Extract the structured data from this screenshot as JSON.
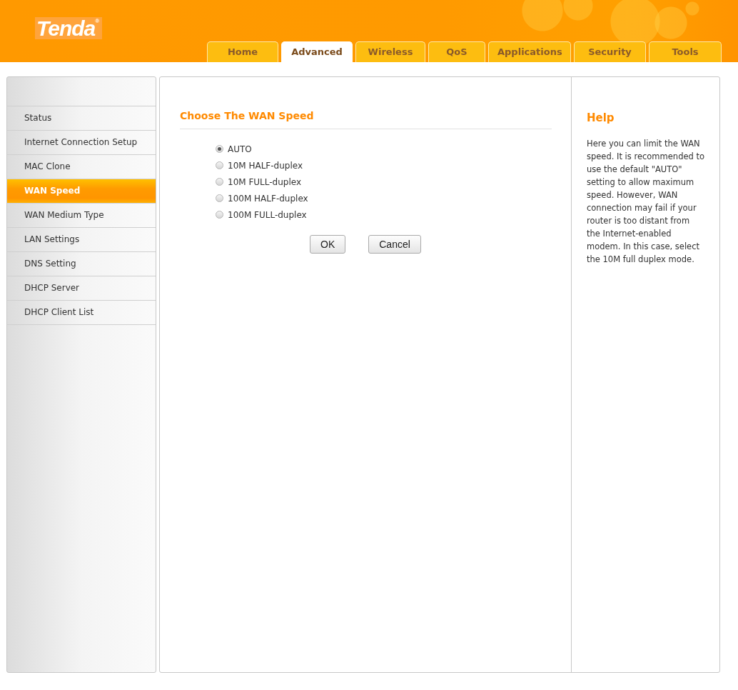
{
  "logo": {
    "text": "Tenda",
    "mark": "®"
  },
  "tabs": [
    {
      "label": "Home",
      "selected": false
    },
    {
      "label": "Advanced",
      "selected": true
    },
    {
      "label": "Wireless",
      "selected": false
    },
    {
      "label": "QoS",
      "selected": false
    },
    {
      "label": "Applications",
      "selected": false
    },
    {
      "label": "Security",
      "selected": false
    },
    {
      "label": "Tools",
      "selected": false
    }
  ],
  "sidebar": {
    "items": [
      {
        "label": "Status",
        "selected": false
      },
      {
        "label": "Internet Connection Setup",
        "selected": false
      },
      {
        "label": "MAC Clone",
        "selected": false
      },
      {
        "label": "WAN Speed",
        "selected": true
      },
      {
        "label": "WAN Medium Type",
        "selected": false
      },
      {
        "label": "LAN Settings",
        "selected": false
      },
      {
        "label": "DNS Setting",
        "selected": false
      },
      {
        "label": "DHCP Server",
        "selected": false
      },
      {
        "label": "DHCP Client List",
        "selected": false
      }
    ]
  },
  "form": {
    "title": "Choose The WAN Speed",
    "options": [
      {
        "label": "AUTO",
        "selected": true
      },
      {
        "label": "10M HALF-duplex",
        "selected": false
      },
      {
        "label": "10M FULL-duplex",
        "selected": false
      },
      {
        "label": "100M HALF-duplex",
        "selected": false
      },
      {
        "label": "100M FULL-duplex",
        "selected": false
      }
    ],
    "buttons": [
      "OK",
      "Cancel"
    ]
  },
  "help": {
    "title": "Help",
    "text": "Here you can limit the WAN speed. It is recommended to use the default \"AUTO\" setting to allow maximum speed. However, WAN connection may fail if your router is too distant from the Internet-enabled modem. In this case, select the 10M full duplex mode."
  }
}
